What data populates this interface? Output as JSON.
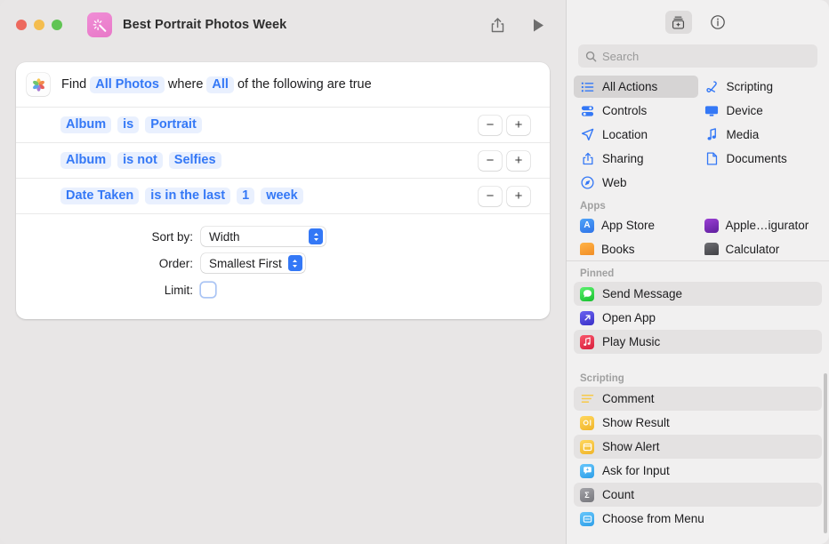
{
  "window": {
    "title": "Best Portrait Photos Week",
    "app_icon": "shortcuts-icon",
    "traffic_lights": [
      "close-red",
      "minimize-yellow",
      "zoom-green"
    ],
    "share_label": "Share",
    "run_label": "Run"
  },
  "find_card": {
    "source_icon": "photos-app-icon",
    "sentence": {
      "find_label": "Find",
      "source_token": "All Photos",
      "where_label": "where",
      "match_token": "All",
      "tail_label": "of the following are true"
    },
    "filters": [
      {
        "field": "Album",
        "operator": "is",
        "value": "Portrait",
        "extra": null,
        "unit": null
      },
      {
        "field": "Album",
        "operator": "is not",
        "value": "Selfies",
        "extra": null,
        "unit": null
      },
      {
        "field": "Date Taken",
        "operator": "is in the last",
        "value": "1",
        "extra": null,
        "unit": "week"
      }
    ],
    "row_buttons": {
      "remove": "−",
      "add": "+"
    },
    "sort": {
      "sort_by_label": "Sort by:",
      "sort_by_value": "Width",
      "order_label": "Order:",
      "order_value": "Smallest First",
      "limit_label": "Limit:",
      "limit_checked": false
    }
  },
  "library": {
    "toolbar": [
      {
        "name": "action-library-button",
        "icon": "library-box-icon",
        "active": true
      },
      {
        "name": "shortcut-details-button",
        "icon": "info-circle-icon",
        "active": false
      }
    ],
    "search": {
      "placeholder": "Search",
      "value": "",
      "icon": "search-icon"
    },
    "categories": [
      {
        "label": "All Actions",
        "icon": "list-bullet-icon",
        "selected": true
      },
      {
        "label": "Scripting",
        "icon": "scripting-icon",
        "selected": false
      },
      {
        "label": "Controls",
        "icon": "controls-icon",
        "selected": false
      },
      {
        "label": "Device",
        "icon": "device-display-icon",
        "selected": false
      },
      {
        "label": "Location",
        "icon": "location-arrow-icon",
        "selected": false
      },
      {
        "label": "Media",
        "icon": "music-note-icon",
        "selected": false
      },
      {
        "label": "Sharing",
        "icon": "share-up-icon",
        "selected": false
      },
      {
        "label": "Documents",
        "icon": "document-page-icon",
        "selected": false
      },
      {
        "label": "Web",
        "icon": "safari-compass-icon",
        "selected": false
      }
    ],
    "apps_section": {
      "label": "Apps",
      "items": [
        {
          "label": "App Store",
          "icon": "app-store-icon",
          "color": "#3e8ef7"
        },
        {
          "label": "Apple…igurator",
          "icon": "apple-configurator-icon",
          "color": "#7c2ec2"
        },
        {
          "label": "Books",
          "icon": "books-icon",
          "color": "#f79a2b"
        },
        {
          "label": "Calculator",
          "icon": "calculator-icon",
          "color": "#5b5b5b"
        }
      ]
    },
    "pinned_section": {
      "label": "Pinned",
      "items": [
        {
          "label": "Send Message",
          "icon": "messages-icon",
          "color": "#3fcc55",
          "zebra": true
        },
        {
          "label": "Open App",
          "icon": "open-app-icon",
          "color": "#4a45e0",
          "zebra": false
        },
        {
          "label": "Play Music",
          "icon": "music-icon",
          "color": "#e8384f",
          "zebra": true
        }
      ]
    },
    "scripting_section": {
      "label": "Scripting",
      "items": [
        {
          "label": "Comment",
          "icon": "comment-icon",
          "color": "#f7c948",
          "zebra": true
        },
        {
          "label": "Show Result",
          "icon": "show-result-icon",
          "color": "#f7c948",
          "zebra": false
        },
        {
          "label": "Show Alert",
          "icon": "show-alert-icon",
          "color": "#f7c948",
          "zebra": true
        },
        {
          "label": "Ask for Input",
          "icon": "ask-input-icon",
          "color": "#4bb3f5",
          "zebra": false
        },
        {
          "label": "Count",
          "icon": "count-sigma-icon",
          "color": "#8e8e93",
          "zebra": true
        },
        {
          "label": "Choose from Menu",
          "icon": "choose-menu-icon",
          "color": "#4bb3f5",
          "zebra": false
        }
      ]
    }
  },
  "colors": {
    "accent": "#3478f6",
    "token_bg": "#e9f0fe",
    "window_bg": "#e8e6e6",
    "library_bg": "#f1f0f0",
    "selected_row": "#d6d4d4"
  }
}
